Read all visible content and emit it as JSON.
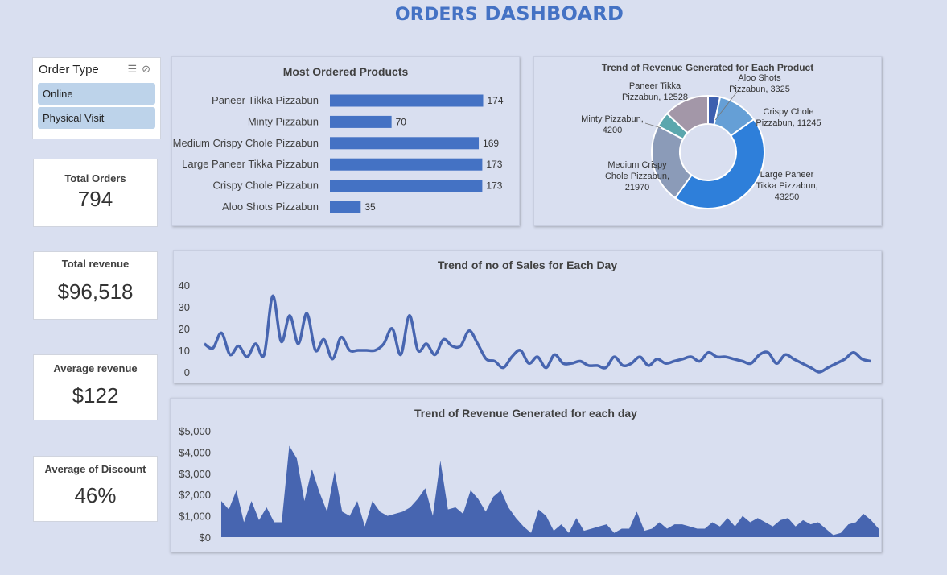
{
  "header": {
    "title_part1": "ORDERS",
    "title_part2": "DASHBOARD"
  },
  "slicer": {
    "title": "Order Type",
    "items": [
      {
        "label": "Online"
      },
      {
        "label": "Physical Visit"
      }
    ],
    "icons": [
      "multi-select-icon",
      "clear-filter-icon"
    ]
  },
  "kpis": [
    {
      "label": "Total Orders",
      "value": "794"
    },
    {
      "label": "Total revenue",
      "value": "$96,518"
    },
    {
      "label": "Average revenue",
      "value": "$122"
    },
    {
      "label": "Average of Discount",
      "value": "46%"
    }
  ],
  "colors": {
    "bar": "#4472c4",
    "area": "#4765b0",
    "line": "#4765b0",
    "title": "#4472c4"
  },
  "chart_data": [
    {
      "type": "bar",
      "title": "Most Ordered Products",
      "categories": [
        "Paneer Tikka Pizzabun",
        "Minty Pizzabun",
        "Medium Crispy Chole Pizzabun",
        "Large Paneer Tikka Pizzabun",
        "Crispy Chole Pizzabun",
        "Aloo Shots Pizzabun"
      ],
      "values": [
        174,
        70,
        169,
        173,
        173,
        35
      ],
      "xlim": [
        0,
        180
      ]
    },
    {
      "type": "pie",
      "title": "Trend of Revenue Generated for Each Product",
      "labels": [
        "Aloo Shots Pizzabun",
        "Crispy Chole Pizzabun",
        "Large Paneer Tikka Pizzabun",
        "Medium Crispy Chole Pizzabun",
        "Minty Pizzabun",
        "Paneer Tikka Pizzabun"
      ],
      "values": [
        3325,
        11245,
        43250,
        21970,
        4200,
        12528
      ],
      "colors": [
        "#3d5faf",
        "#659fd6",
        "#2e7fda",
        "#8b9bb8",
        "#5ba7ad",
        "#a397a8"
      ]
    },
    {
      "type": "line",
      "title": "Trend of no of Sales for Each Day",
      "ylim": [
        0,
        40
      ],
      "yticks": [
        "0",
        "10",
        "20",
        "30",
        "40"
      ],
      "values": [
        13,
        11,
        18,
        8,
        12,
        7,
        13,
        8,
        35,
        14,
        26,
        13,
        27,
        10,
        15,
        6,
        16,
        10,
        10,
        10,
        10,
        13,
        20,
        8,
        26,
        10,
        13,
        8,
        15,
        12,
        12,
        19,
        13,
        6,
        5,
        2,
        7,
        10,
        4,
        7,
        2,
        8,
        4,
        4,
        5,
        3,
        3,
        2,
        7,
        3,
        4,
        7,
        3,
        6,
        4,
        5,
        6,
        7,
        5,
        9,
        7,
        7,
        6,
        5,
        4,
        8,
        9,
        4,
        8,
        6,
        4,
        2,
        0,
        2,
        4,
        6,
        9,
        6,
        5
      ]
    },
    {
      "type": "area",
      "title": "Trend of Revenue Generated for each day",
      "ylim": [
        0,
        5000
      ],
      "yticks": [
        "$0",
        "$1,000",
        "$2,000",
        "$3,000",
        "$4,000",
        "$5,000"
      ],
      "values": [
        1700,
        1300,
        2200,
        700,
        1700,
        800,
        1400,
        700,
        700,
        4300,
        3700,
        1700,
        3200,
        2100,
        1200,
        3100,
        1200,
        1000,
        1700,
        500,
        1700,
        1200,
        1000,
        1100,
        1200,
        1400,
        1800,
        2300,
        1000,
        3600,
        1300,
        1400,
        1100,
        2200,
        1800,
        1200,
        1900,
        2200,
        1400,
        900,
        500,
        200,
        1300,
        1000,
        300,
        600,
        200,
        900,
        300,
        400,
        500,
        600,
        200,
        400,
        400,
        1200,
        300,
        400,
        700,
        400,
        600,
        600,
        500,
        400,
        400,
        700,
        500,
        900,
        500,
        1000,
        700,
        900,
        700,
        500,
        800,
        900,
        500,
        800,
        600,
        700,
        400,
        100,
        200,
        600,
        700,
        1100,
        800,
        400
      ]
    }
  ]
}
